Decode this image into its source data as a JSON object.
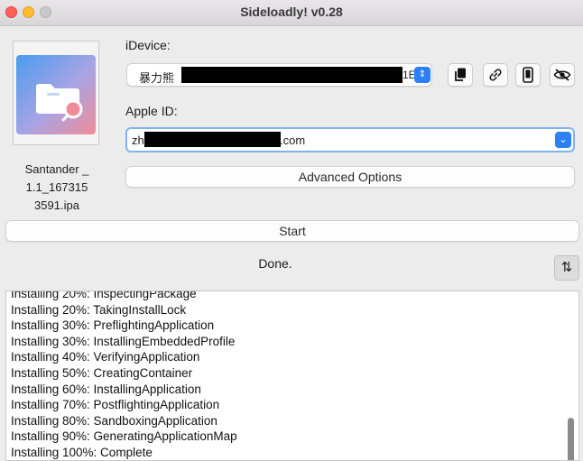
{
  "window": {
    "title": "Sideloadly! v0.28"
  },
  "app_file": {
    "name": "Santander _\n1.1_167315\n3591.ipa"
  },
  "device": {
    "label": "iDevice:",
    "value_prefix": "暴力熊",
    "value_suffix": "1E"
  },
  "toolbar_icons": [
    "copy-icon",
    "link-icon",
    "phone-icon",
    "eye-slash-icon"
  ],
  "apple_id": {
    "label": "Apple ID:",
    "value_prefix": "zh",
    "value_suffix": ".com"
  },
  "buttons": {
    "advanced_options": "Advanced Options",
    "start": "Start",
    "sort": "⇅"
  },
  "status_text": "Done.",
  "log_lines": [
    "Installing 20%: InspectingPackage",
    "Installing 20%: TakingInstallLock",
    "Installing 30%: PreflightingApplication",
    "Installing 30%: InstallingEmbeddedProfile",
    "Installing 40%: VerifyingApplication",
    "Installing 50%: CreatingContainer",
    "Installing 60%: InstallingApplication",
    "Installing 70%: PostflightingApplication",
    "Installing 80%: SandboxingApplication",
    "Installing 90%: GeneratingApplicationMap",
    "Installing 100%: Complete"
  ],
  "colors": {
    "accent": "#2d7ff5",
    "focus_ring": "#7fb2f0",
    "close": "#fe5f57",
    "minimize": "#febc2e"
  }
}
